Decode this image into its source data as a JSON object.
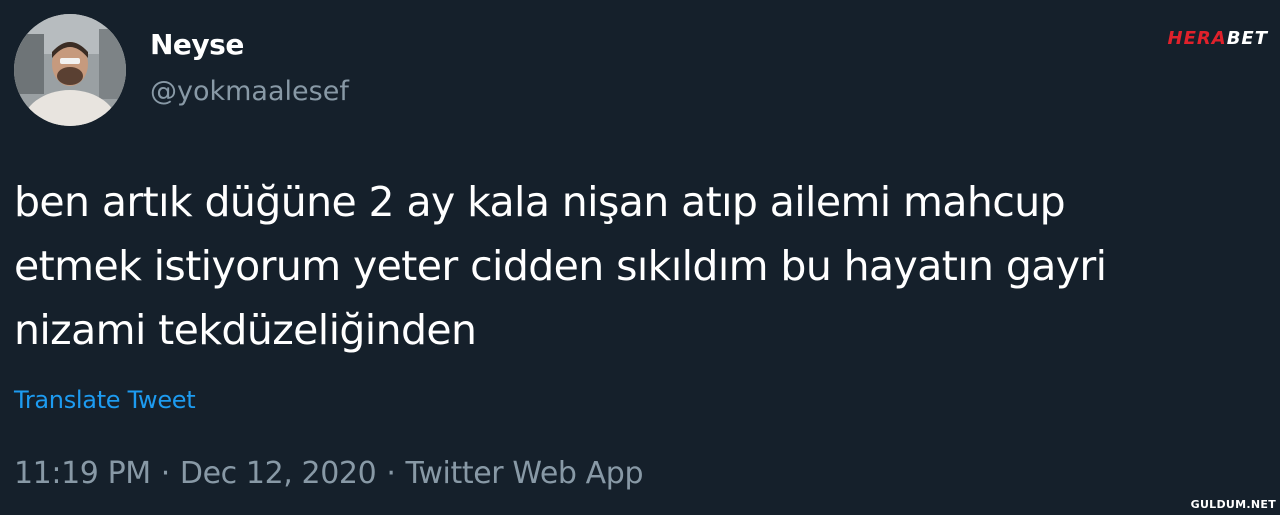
{
  "tweet": {
    "display_name": "Neyse",
    "handle": "@yokmaalesef",
    "text": "ben artık düğüne 2 ay kala nişan atıp ailemi mahcup\netmek istiyorum yeter cidden sıkıldım bu hayatın gayri\nnizami tekdüzeliğinden",
    "translate_label": "Translate Tweet",
    "time": "11:19 PM",
    "separator": "·",
    "date": "Dec 12, 2020",
    "source": "Twitter Web App",
    "avatar_icon": "profile-photo"
  },
  "overlay": {
    "brand_part1": "HERA",
    "brand_part2": "BET",
    "watermark": "GULDUM.NET"
  },
  "colors": {
    "background": "#15202b",
    "text": "#ffffff",
    "secondary": "#8899a6",
    "link": "#1d9bf0",
    "brand_red": "#e0212b"
  }
}
